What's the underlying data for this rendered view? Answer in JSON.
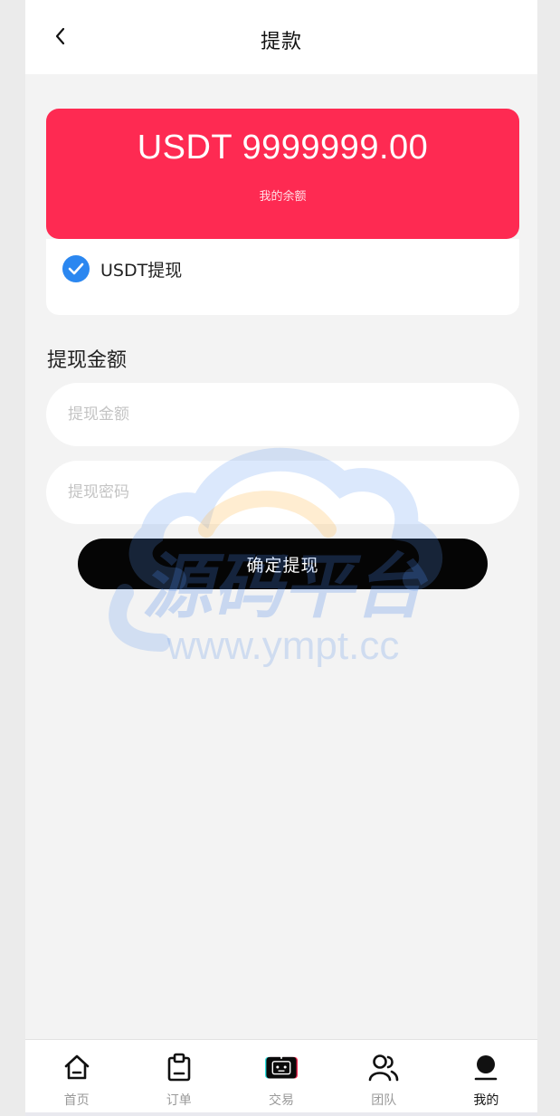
{
  "header": {
    "title": "提款",
    "back_icon": "chevron-left-icon"
  },
  "balance": {
    "amount": "USDT 9999999.00",
    "label": "我的余额",
    "color": "#fe2a52"
  },
  "method": {
    "label": "USDT提现",
    "selected": true,
    "check_color": "#2b87f0"
  },
  "form": {
    "section_title": "提现金额",
    "amount_placeholder": "提现金额",
    "amount_value": "",
    "password_placeholder": "提现密码",
    "password_value": "",
    "submit_label": "确定提现"
  },
  "watermark": {
    "brand": "源码平台",
    "url": "www.ympt.cc"
  },
  "tabbar": {
    "items": [
      {
        "label": "首页",
        "icon": "home-icon",
        "active": false
      },
      {
        "label": "订单",
        "icon": "clipboard-icon",
        "active": false
      },
      {
        "label": "交易",
        "icon": "robot-icon",
        "active": false
      },
      {
        "label": "团队",
        "icon": "team-icon",
        "active": false
      },
      {
        "label": "我的",
        "icon": "user-icon",
        "active": true
      }
    ]
  }
}
